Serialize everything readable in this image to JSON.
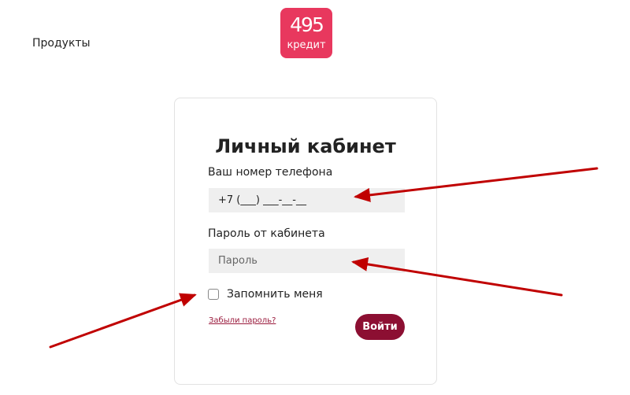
{
  "header": {
    "nav_products": "Продукты",
    "logo": {
      "number": "495",
      "word": "кредит"
    }
  },
  "login": {
    "title": "Личный кабинет",
    "phone_label": "Ваш номер телефона",
    "phone_value": "+7 (___) ___-__-__",
    "password_label": "Пароль от кабинета",
    "password_placeholder": "Пароль",
    "remember_label": "Запомнить меня",
    "remember_checked": false,
    "forgot_link": "Забыли пароль?",
    "submit_label": "Войти"
  },
  "annotations": {
    "arrow_count": 3,
    "arrow_color": "#c00000"
  },
  "colors": {
    "logo_bg": "#e8385e",
    "submit_bg": "#8c0f32",
    "link": "#9a1b3d",
    "input_bg": "#efefef"
  }
}
